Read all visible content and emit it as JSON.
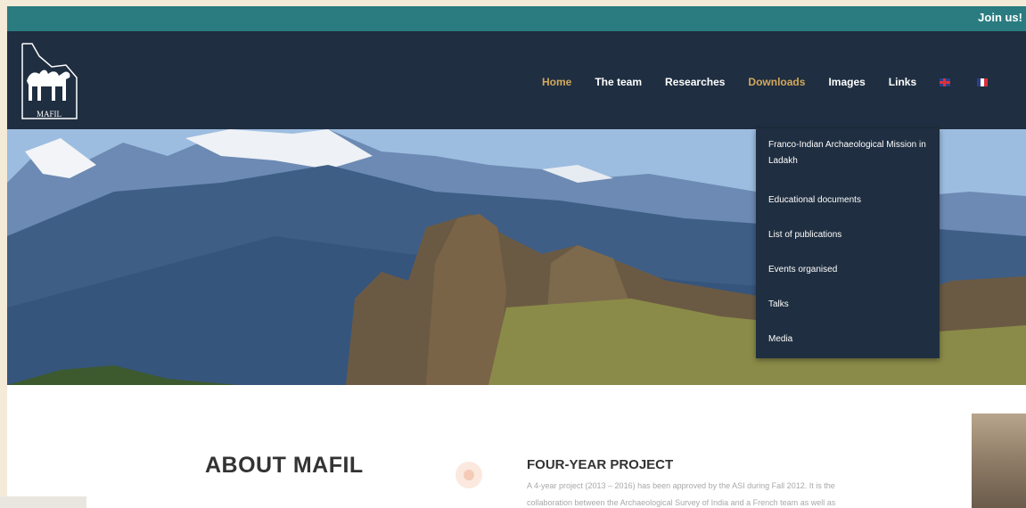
{
  "topbar": {
    "join_label": "Join us!"
  },
  "logo": {
    "text": "MAFIL",
    "icon": "camel-logo-icon"
  },
  "nav": {
    "items": [
      {
        "label": "Home"
      },
      {
        "label": "The team"
      },
      {
        "label": "Researches"
      },
      {
        "label": "Downloads"
      },
      {
        "label": "Images"
      },
      {
        "label": "Links"
      }
    ],
    "active": "Downloads",
    "flags": [
      "uk-flag-icon",
      "france-flag-icon"
    ]
  },
  "dropdown": {
    "items": [
      {
        "label": "Franco-Indian Archaeological Mission in Ladakh"
      },
      {
        "label": "Educational documents"
      },
      {
        "label": "List of publications"
      },
      {
        "label": "Events organised"
      },
      {
        "label": "Talks"
      },
      {
        "label": "Media"
      }
    ]
  },
  "content": {
    "about_title": "ABOUT MAFIL",
    "project_title": "FOUR-YEAR PROJECT",
    "project_lines": [
      "A 4-year project (2013 – 2016) has been approved by the ASI during Fall 2012. It is the",
      "collaboration between the Archaeological Survey of India and a French team as well as"
    ]
  },
  "colors": {
    "topbar": "#2a7c80",
    "header": "#1f2e40",
    "accent": "#d2a85e"
  }
}
